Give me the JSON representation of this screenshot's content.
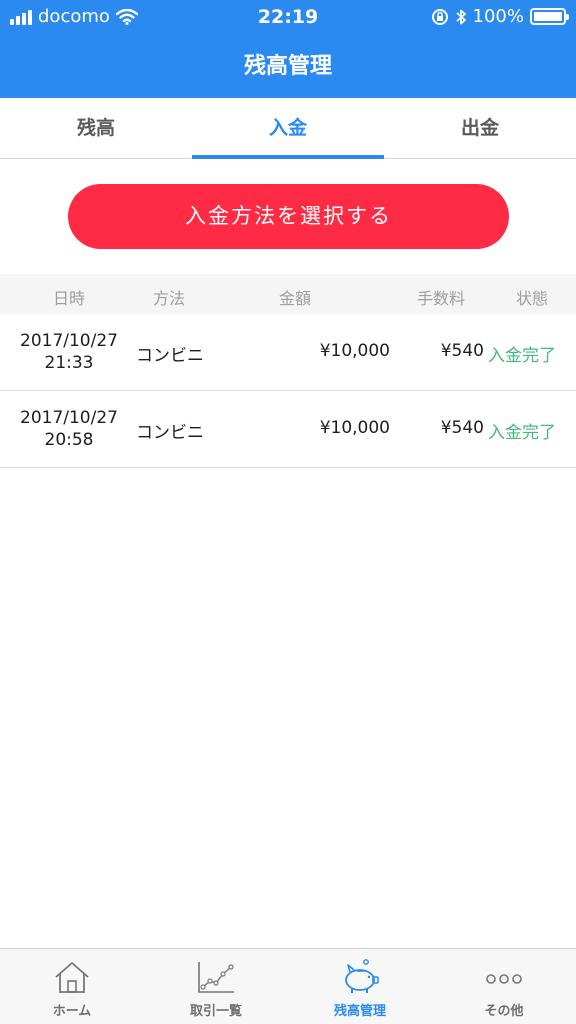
{
  "status_bar": {
    "carrier": "docomo",
    "time": "22:19",
    "battery": "100%",
    "battery_level": 1.0
  },
  "header": {
    "title": "残高管理"
  },
  "tabs": [
    {
      "label": "残高",
      "active": false
    },
    {
      "label": "入金",
      "active": true
    },
    {
      "label": "出金",
      "active": false
    }
  ],
  "action": {
    "select_label": "入金方法を選択する"
  },
  "table": {
    "headers": {
      "date": "日時",
      "method": "方法",
      "amount": "金額",
      "fee": "手数料",
      "status": "状態"
    },
    "rows": [
      {
        "date": "2017/10/27",
        "time": "21:33",
        "method": "コンビニ",
        "amount": "¥10,000",
        "fee": "¥540",
        "status": "入金完了"
      },
      {
        "date": "2017/10/27",
        "time": "20:58",
        "method": "コンビニ",
        "amount": "¥10,000",
        "fee": "¥540",
        "status": "入金完了"
      }
    ]
  },
  "tabbar": [
    {
      "label": "ホーム",
      "icon": "home-icon"
    },
    {
      "label": "取引一覧",
      "icon": "chart-icon"
    },
    {
      "label": "残高管理",
      "icon": "piggy-bank-icon",
      "active": true
    },
    {
      "label": "その他",
      "icon": "more-icon"
    }
  ],
  "colors": {
    "primary_blue": "#2a8af0",
    "button_red": "#ff2b44",
    "status_green": "#45b97c"
  }
}
